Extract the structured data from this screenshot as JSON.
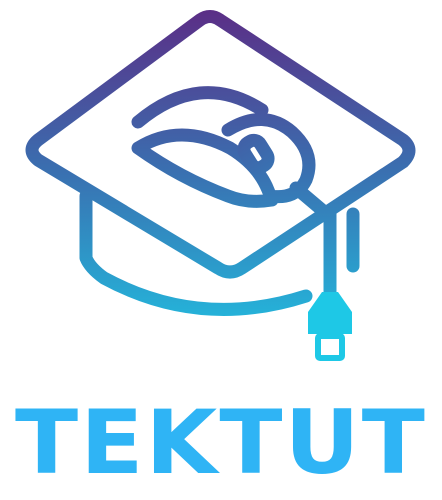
{
  "brand": {
    "name": "TEKTUT",
    "colors": {
      "gradient_top": "#5b2e86",
      "gradient_mid": "#3a6fb0",
      "gradient_bottom": "#1ec8e6",
      "wordmark": "#2fb4f5"
    }
  },
  "icons": {
    "mark": "graduation-cap-with-computer-mouse-icon"
  }
}
